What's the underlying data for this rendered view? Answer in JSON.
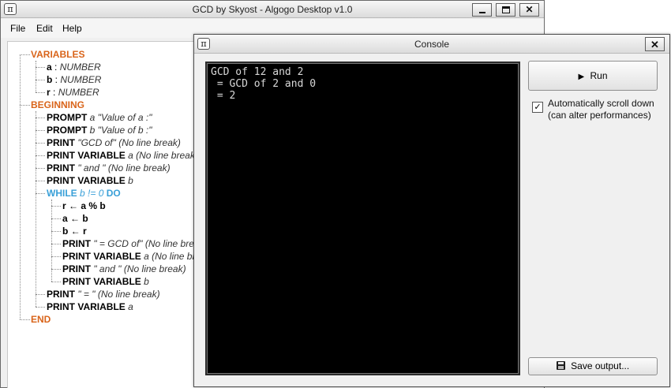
{
  "main_window": {
    "title": "GCD by Skyost - Algogo Desktop v1.0",
    "icon_glyph": "π",
    "menu": [
      "File",
      "Edit",
      "Help"
    ]
  },
  "tree": {
    "variables": {
      "label": "VARIABLES",
      "items": [
        {
          "name": "a",
          "sep": " : ",
          "type": "NUMBER"
        },
        {
          "name": "b",
          "sep": " : ",
          "type": "NUMBER"
        },
        {
          "name": "r",
          "sep": " : ",
          "type": "NUMBER"
        }
      ]
    },
    "beginning": {
      "label": "BEGINNING",
      "statements": [
        {
          "kw": "PROMPT",
          "arg": " a \"Value of a :\""
        },
        {
          "kw": "PROMPT",
          "arg": " b \"Value of b :\""
        },
        {
          "kw": "PRINT",
          "arg": " \"GCD of\" (No line break)"
        },
        {
          "kw": "PRINT VARIABLE",
          "arg": " a (No line break)"
        },
        {
          "kw": "PRINT",
          "arg": " \" and \" (No line break)"
        },
        {
          "kw": "PRINT VARIABLE",
          "arg": " b"
        }
      ],
      "while_loop": {
        "kw": "WHILE",
        "cond": " b != 0 ",
        "kw_end": "DO",
        "body": [
          {
            "kw": "r ← a % b",
            "arg": ""
          },
          {
            "kw": "a ← b",
            "arg": ""
          },
          {
            "kw": "b ← r",
            "arg": ""
          },
          {
            "kw": "PRINT",
            "arg": " \" = GCD of\" (No line break)"
          },
          {
            "kw": "PRINT VARIABLE",
            "arg": " a (No line break)"
          },
          {
            "kw": "PRINT",
            "arg": " \" and \" (No line break)"
          },
          {
            "kw": "PRINT VARIABLE",
            "arg": " b"
          }
        ]
      },
      "after_loop": [
        {
          "kw": "PRINT",
          "arg": " \" = \" (No line break)"
        },
        {
          "kw": "PRINT VARIABLE",
          "arg": " a"
        }
      ]
    },
    "end_label": "END"
  },
  "console": {
    "title": "Console",
    "icon_glyph": "π",
    "close_glyph": "✕",
    "output": [
      "GCD of 12 and 2",
      " = GCD of 2 and 0",
      " = 2"
    ],
    "run_label": "Run",
    "run_icon": "▶",
    "autoscroll_checked": true,
    "check_glyph": "✓",
    "autoscroll_label_line1": "Automatically scroll down",
    "autoscroll_label_line2": "(can alter performances)",
    "save_label": "Save output...",
    "save_icon": "floppy-disk-icon"
  },
  "colors": {
    "keyword_orange": "#d9641a",
    "keyword_blue": "#3aa0d8",
    "console_bg": "#000000",
    "console_text": "#d8d8d8"
  }
}
